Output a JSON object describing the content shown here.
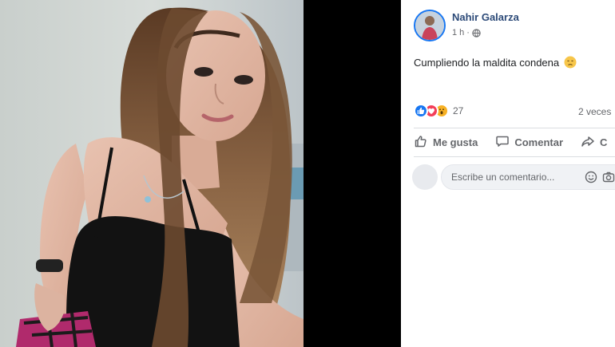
{
  "post": {
    "author": "Nahir Galarza",
    "time": "1 h",
    "separator": "·",
    "text": "Cumpliendo la maldita condena",
    "reactions_count": "27",
    "shares": "2 veces"
  },
  "actions": {
    "like": "Me gusta",
    "comment": "Comentar",
    "share": "C"
  },
  "comment_box": {
    "placeholder": "Escribe un comentario..."
  },
  "icons": {
    "privacy": "globe-icon",
    "text_emoji": "sad-face-icon",
    "reactions": [
      "like-icon",
      "love-icon",
      "wow-icon"
    ],
    "like_action": "thumbs-up-icon",
    "comment_action": "speech-bubble-icon",
    "share_action": "share-arrow-icon",
    "comment_emoji": "smiley-icon",
    "comment_camera": "camera-icon"
  },
  "colors": {
    "author_name": "#2c4a78",
    "like_blue": "#1877f2",
    "love_red": "#f33e58",
    "wow_yellow": "#f7b125",
    "meta_gray": "#65676b"
  }
}
